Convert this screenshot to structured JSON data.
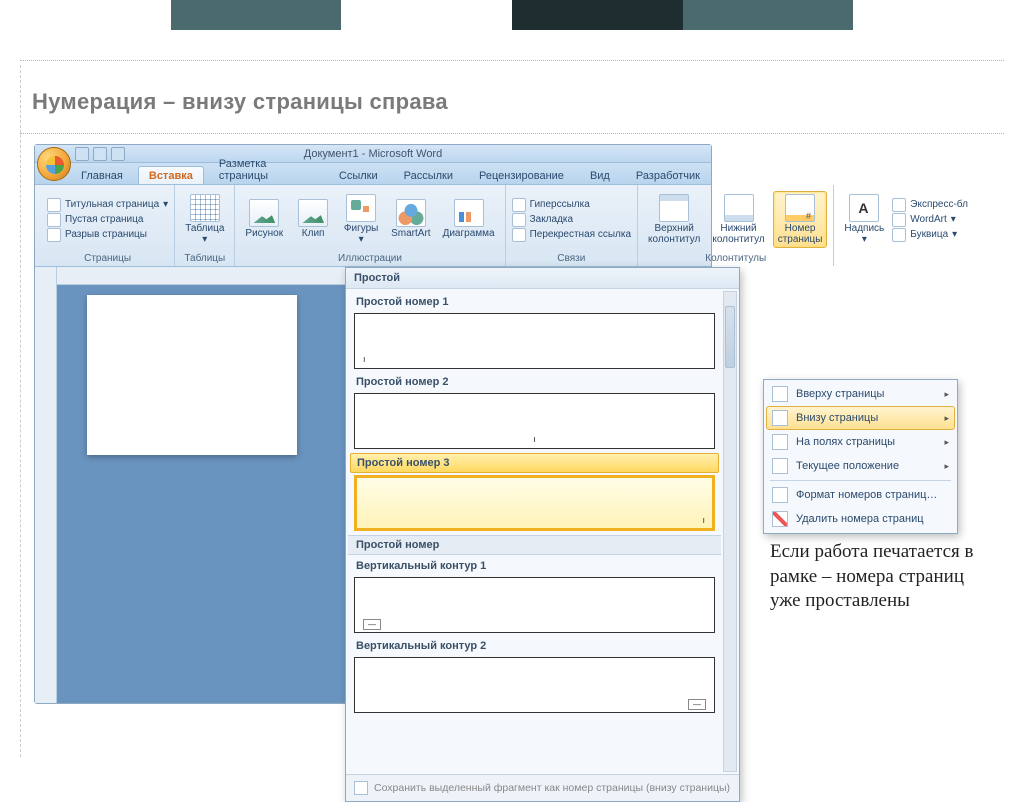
{
  "slide": {
    "title": "Нумерация – внизу страницы справа",
    "note": "Если работа печатается в рамке – номера страниц уже проставлены"
  },
  "word": {
    "title": "Документ1 - Microsoft Word",
    "tabs": {
      "home": "Главная",
      "insert": "Вставка",
      "layout": "Разметка страницы",
      "refs": "Ссылки",
      "mail": "Рассылки",
      "review": "Рецензирование",
      "view": "Вид",
      "dev": "Разработчик"
    },
    "groups": {
      "pages": {
        "label": "Страницы",
        "cover": "Титульная страница",
        "blank": "Пустая страница",
        "break": "Разрыв страницы"
      },
      "tables": {
        "label": "Таблицы",
        "table": "Таблица"
      },
      "illus": {
        "label": "Иллюстрации",
        "pic": "Рисунок",
        "clip": "Клип",
        "shapes": "Фигуры",
        "smart": "SmartArt",
        "chart": "Диаграмма"
      },
      "links": {
        "label": "Связи",
        "hyper": "Гиперссылка",
        "book": "Закладка",
        "cross": "Перекрестная ссылка"
      },
      "hf": {
        "label": "Колонтитулы",
        "header": "Верхний\nколонтитул",
        "footer": "Нижний\nколонтитул",
        "pagenum": "Номер\nстраницы"
      },
      "text": {
        "textbox": "Надпись",
        "quick": "Экспресс-бл",
        "wordart": "WordArt",
        "dropcap": "Буквица"
      }
    },
    "pagenum_menu": {
      "top": "Вверху страницы",
      "bottom": "Внизу страницы",
      "margins": "На полях страницы",
      "current": "Текущее положение",
      "format": "Формат номеров страниц…",
      "remove": "Удалить номера страниц"
    },
    "gallery": {
      "header": "Простой",
      "opt1": "Простой номер 1",
      "opt2": "Простой номер 2",
      "opt3": "Простой номер 3",
      "sub2": "Простой номер",
      "v1": "Вертикальный контур 1",
      "v2": "Вертикальный контур 2",
      "footer": "Сохранить выделенный фрагмент как номер страницы (внизу страницы)"
    }
  }
}
